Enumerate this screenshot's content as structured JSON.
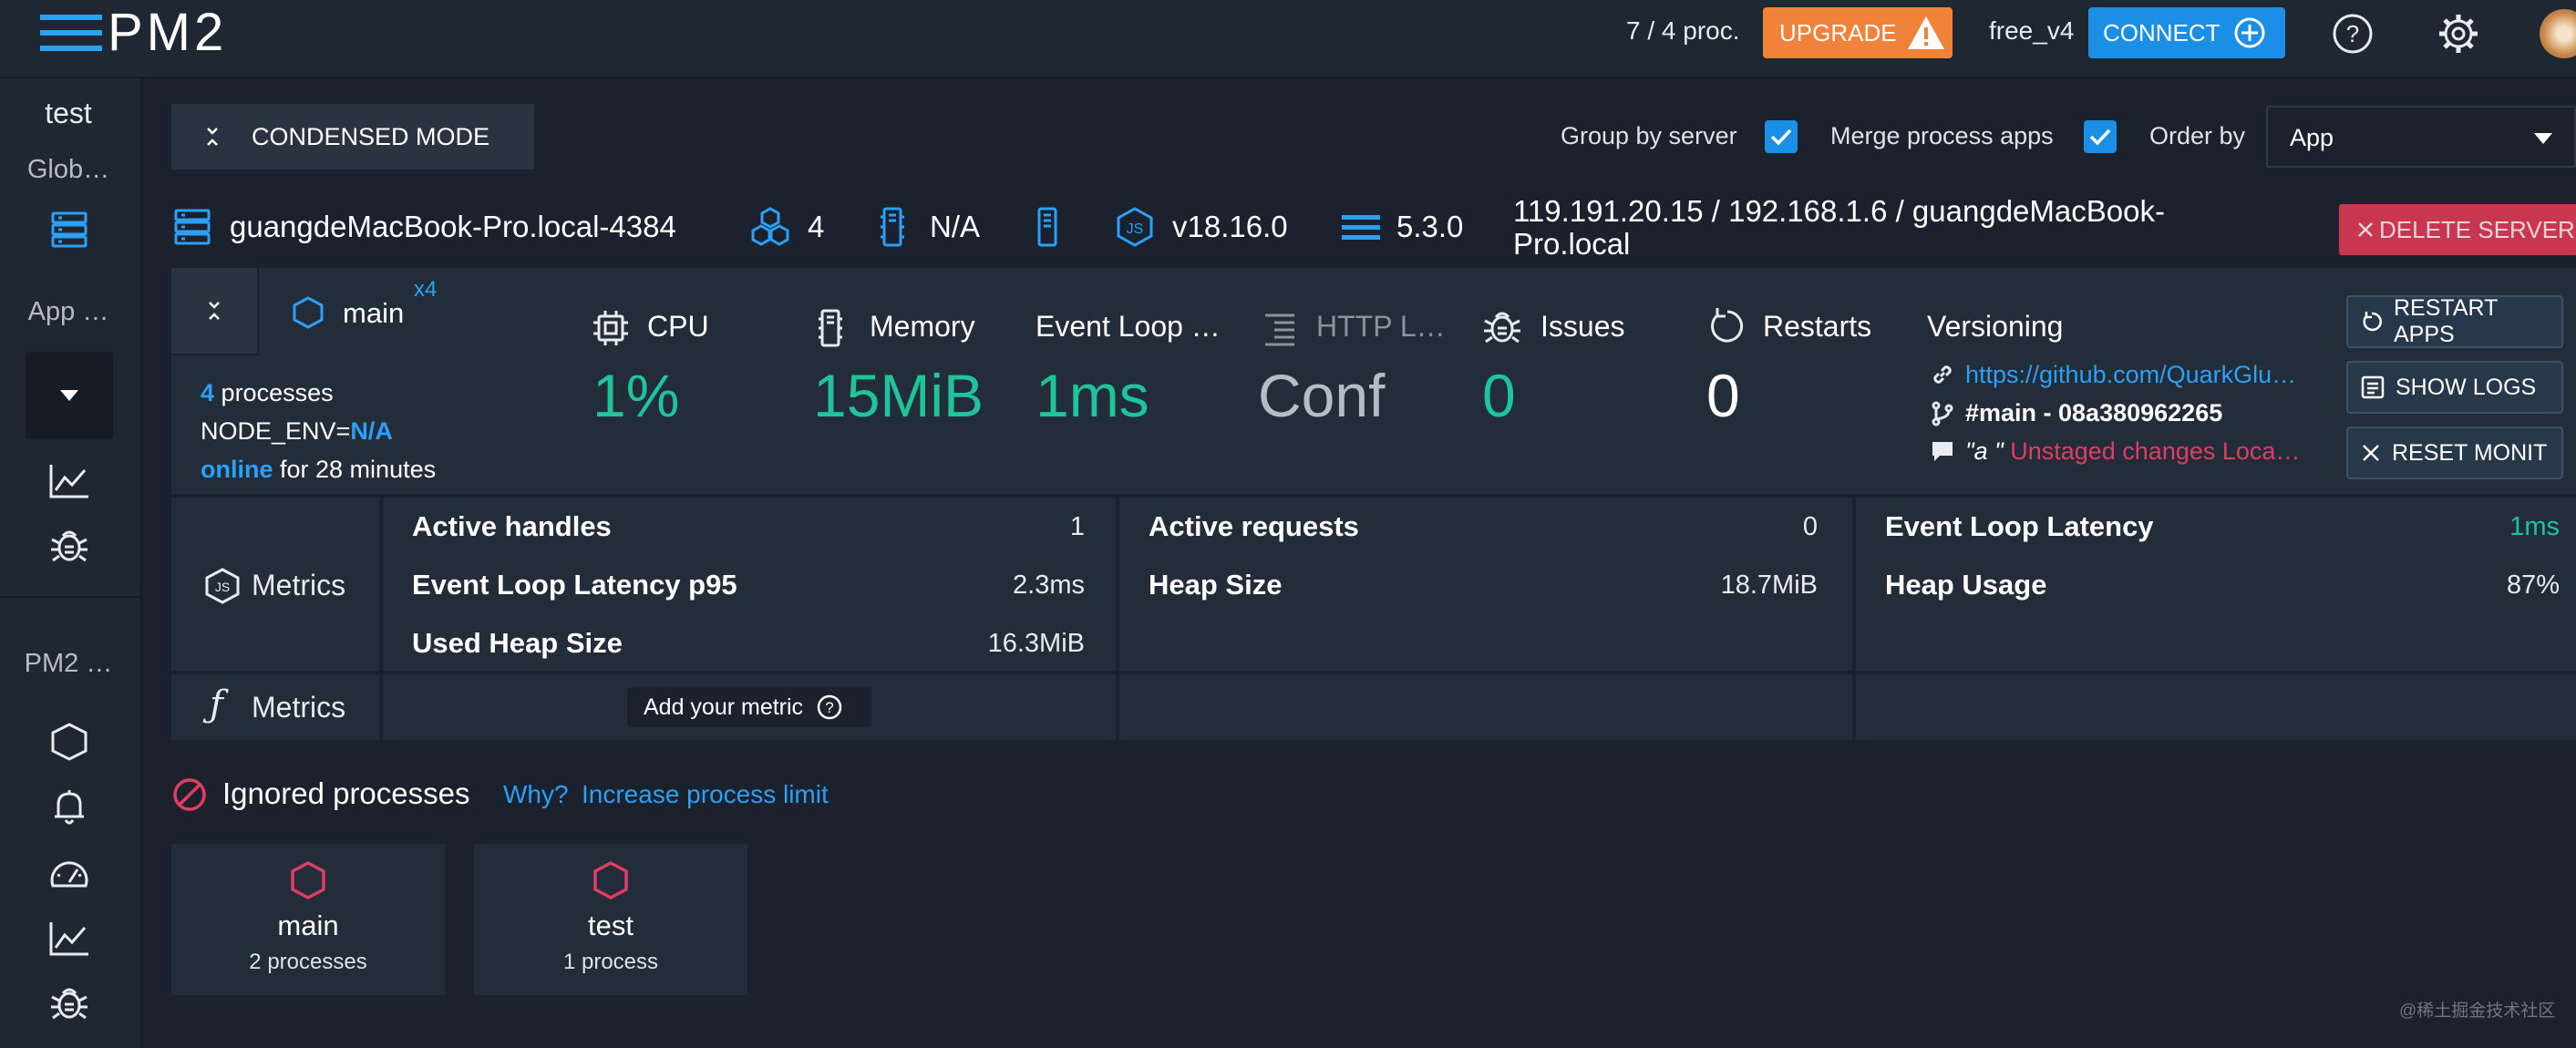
{
  "header": {
    "logo_text": "PM2",
    "proc_count": "7 / 4 proc.",
    "upgrade_label": "UPGRADE",
    "plan_name": "free_v4",
    "connect_label": "CONNECT"
  },
  "sidebar": {
    "bucket_name": "test",
    "global_label": "Glob…",
    "app_label": "App …",
    "pm2_label": "PM2 …"
  },
  "toolbar": {
    "condensed_label": "CONDENSED MODE",
    "group_by_server_label": "Group by server",
    "merge_apps_label": "Merge process apps",
    "order_by_label": "Order by",
    "order_by_value": "App"
  },
  "server": {
    "name": "guangdeMacBook-Pro.local-4384",
    "cpus": "4",
    "memory": "N/A",
    "node_version": "v18.16.0",
    "pm2_version": "5.3.0",
    "address_line1": "119.191.20.15 / 192.168.1.6 / guangdeMacBook-",
    "address_line2": "Pro.local",
    "delete_label": "DELETE SERVER"
  },
  "app": {
    "name": "main",
    "multiplier": "x4",
    "process_count": "4",
    "processes_label": "processes",
    "node_env_label": "NODE_ENV=",
    "node_env_value": "N/A",
    "status": "online",
    "uptime": "for 28 minutes",
    "cpu_label": "CPU",
    "cpu_value": "1%",
    "memory_label": "Memory",
    "memory_value": "15MiB",
    "event_loop_label": "Event Loop …",
    "event_loop_value": "1ms",
    "http_label": "HTTP L…",
    "http_value": "Conf",
    "issues_label": "Issues",
    "issues_value": "0",
    "restarts_label": "Restarts",
    "restarts_value": "0",
    "versioning_label": "Versioning",
    "repo_url": "https://github.com/QuarkGlu…",
    "branch": "#main - 08a380962265",
    "commit_prefix": "\"a \"",
    "commit_text": "Unstaged changes Loca…",
    "restart_apps_label": "RESTART APPS",
    "show_logs_label": "SHOW LOGS",
    "reset_monit_label": "RESET MONIT"
  },
  "metrics": {
    "js_label": "Metrics",
    "custom_label": "Metrics",
    "col1": [
      {
        "label": "Active handles",
        "value": "1"
      },
      {
        "label": "Event Loop Latency p95",
        "value": "2.3ms"
      },
      {
        "label": "Used Heap Size",
        "value": "16.3MiB"
      }
    ],
    "col2": [
      {
        "label": "Active requests",
        "value": "0"
      },
      {
        "label": "Heap Size",
        "value": "18.7MiB"
      }
    ],
    "col3": [
      {
        "label": "Event Loop Latency",
        "value": "1ms"
      },
      {
        "label": "Heap Usage",
        "value": "87%"
      }
    ],
    "add_metric_label": "Add your metric"
  },
  "ignored": {
    "title": "Ignored processes",
    "why_link": "Why?",
    "increase_link": "Increase process limit",
    "cards": [
      {
        "name": "main",
        "count": "2 processes"
      },
      {
        "name": "test",
        "count": "1 process"
      }
    ]
  },
  "watermark": "@稀土掘金技术社区",
  "colors": {
    "accent_blue": "#2ba0f5",
    "accent_green": "#1fc49a",
    "upgrade_orange": "#f0823a",
    "danger_red": "#c8374f",
    "background": "#1b222e",
    "panel": "#232c39"
  }
}
